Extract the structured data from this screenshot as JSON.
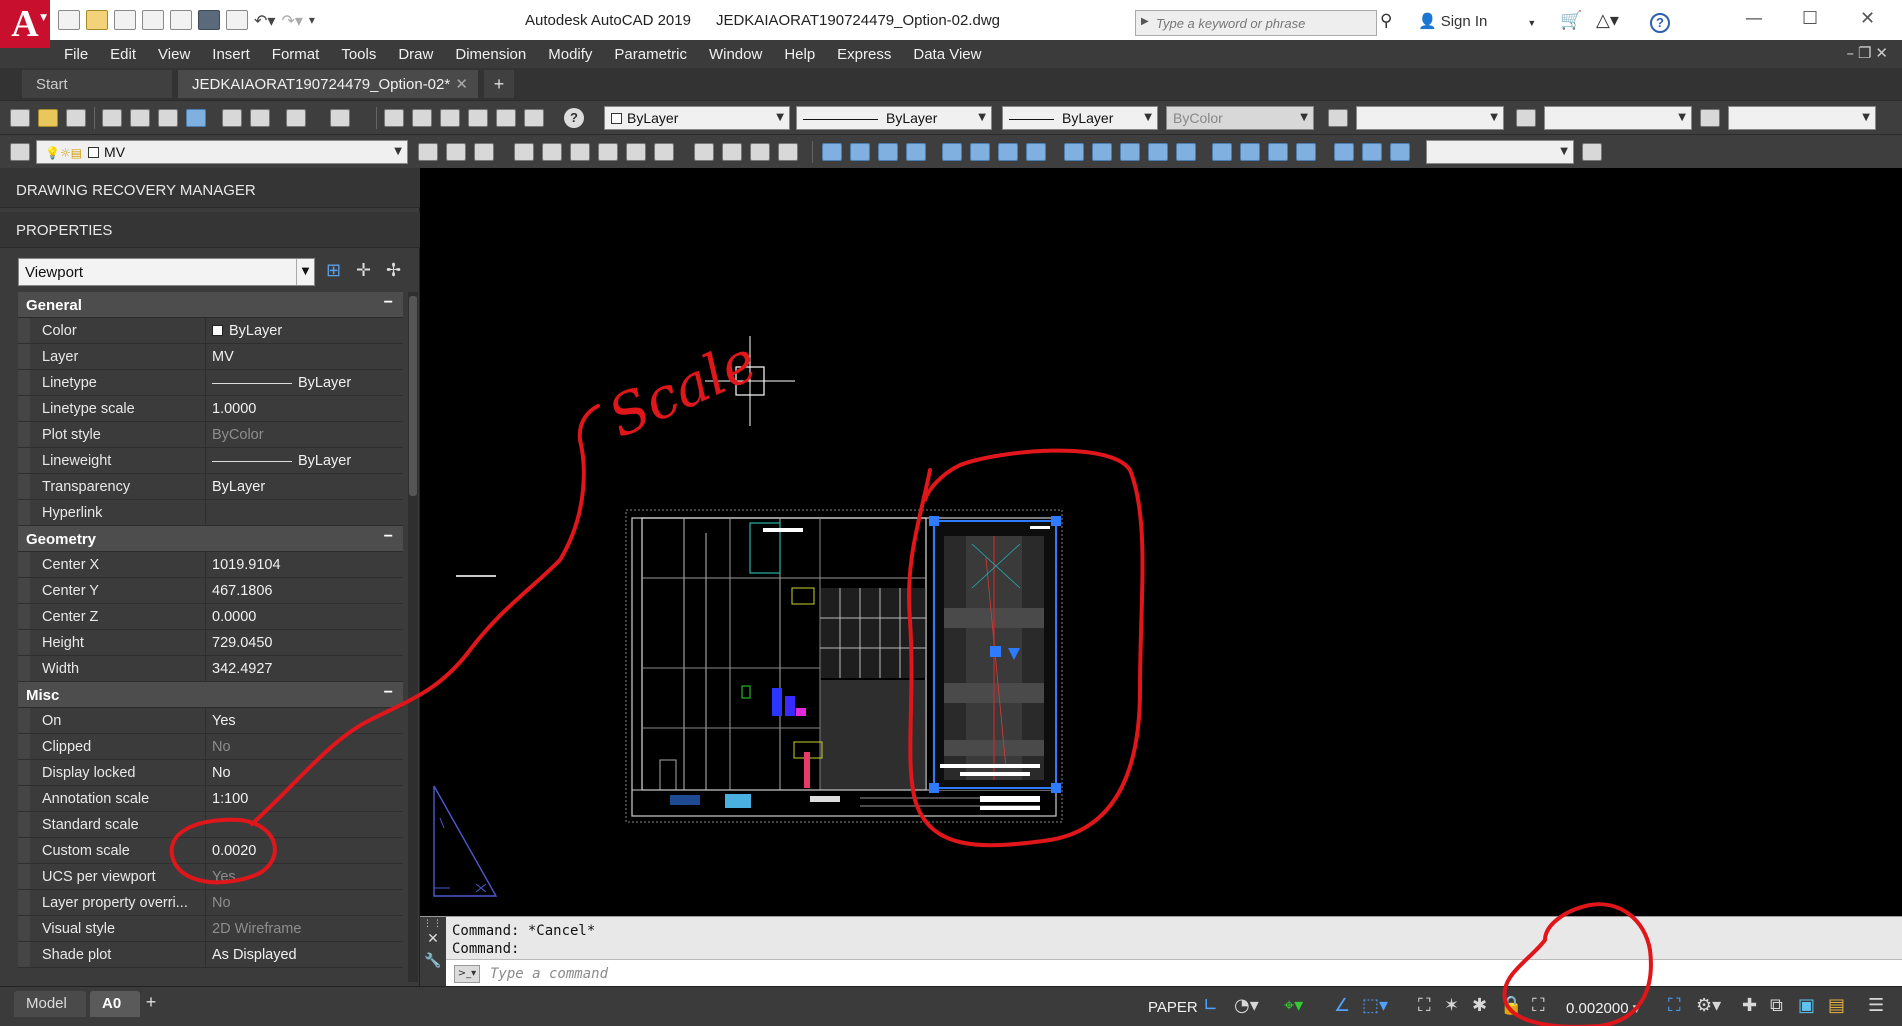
{
  "window": {
    "app_name": "Autodesk AutoCAD 2019",
    "file_name": "JEDKAIAORAT190724479_Option-02.dwg",
    "search_placeholder": "Type a keyword or phrase",
    "sign_in": "Sign In"
  },
  "menu": [
    "File",
    "Edit",
    "View",
    "Insert",
    "Format",
    "Tools",
    "Draw",
    "Dimension",
    "Modify",
    "Parametric",
    "Window",
    "Help",
    "Express",
    "Data View"
  ],
  "tabs": {
    "start": "Start",
    "drawing": "JEDKAIAORAT190724479_Option-02*"
  },
  "toolbar": {
    "color_combo": "ByLayer",
    "linetype_combo": "ByLayer",
    "lineweight_combo": "ByLayer",
    "plotstyle_combo": "ByColor",
    "layer_combo": "MV"
  },
  "palette": {
    "recovery_title": "DRAWING RECOVERY MANAGER",
    "properties_title": "PROPERTIES",
    "object_type": "Viewport",
    "sections": [
      {
        "name": "General",
        "rows": [
          {
            "label": "Color",
            "value": "ByLayer",
            "kind": "swatch"
          },
          {
            "label": "Layer",
            "value": "MV"
          },
          {
            "label": "Linetype",
            "value": "ByLayer",
            "kind": "line"
          },
          {
            "label": "Linetype scale",
            "value": "1.0000"
          },
          {
            "label": "Plot style",
            "value": "ByColor",
            "dim": true
          },
          {
            "label": "Lineweight",
            "value": "ByLayer",
            "kind": "line"
          },
          {
            "label": "Transparency",
            "value": "ByLayer"
          },
          {
            "label": "Hyperlink",
            "value": ""
          }
        ]
      },
      {
        "name": "Geometry",
        "rows": [
          {
            "label": "Center X",
            "value": "1019.9104"
          },
          {
            "label": "Center Y",
            "value": "467.1806"
          },
          {
            "label": "Center Z",
            "value": "0.0000"
          },
          {
            "label": "Height",
            "value": "729.0450"
          },
          {
            "label": "Width",
            "value": "342.4927"
          }
        ]
      },
      {
        "name": "Misc",
        "rows": [
          {
            "label": "On",
            "value": "Yes"
          },
          {
            "label": "Clipped",
            "value": "No",
            "dim": true
          },
          {
            "label": "Display locked",
            "value": "No"
          },
          {
            "label": "Annotation scale",
            "value": "1:100"
          },
          {
            "label": "Standard scale",
            "value": ""
          },
          {
            "label": "Custom scale",
            "value": "0.0020"
          },
          {
            "label": "UCS per viewport",
            "value": "Yes",
            "dim": true
          },
          {
            "label": "Layer property overri...",
            "value": "No",
            "dim": true
          },
          {
            "label": "Visual style",
            "value": "2D Wireframe",
            "dim": true
          },
          {
            "label": "Shade plot",
            "value": "As Displayed"
          }
        ]
      }
    ]
  },
  "command_line": {
    "history": [
      "Command: *Cancel*",
      "Command:"
    ],
    "placeholder": "Type a command"
  },
  "status": {
    "layout_tabs": [
      "Model",
      "A0"
    ],
    "space": "PAPER",
    "viewport_scale": "0.002000"
  },
  "annotation": {
    "handwritten_text": "Scale",
    "color": "#e0161b"
  },
  "colors": {
    "viewport_selection": "#2f7bff",
    "drawing_background": "#000000"
  }
}
